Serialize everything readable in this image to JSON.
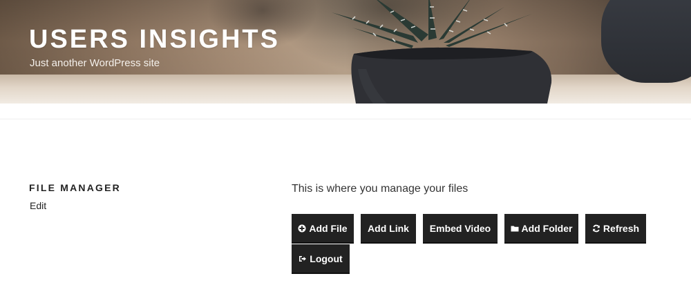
{
  "site": {
    "title": "USERS INSIGHTS",
    "description": "Just another WordPress site"
  },
  "page": {
    "title": "FILE MANAGER",
    "edit_label": "Edit",
    "intro": "This is where you manage your files"
  },
  "toolbar": {
    "buttons": [
      {
        "label": "Add File",
        "icon": "plus-circle-icon"
      },
      {
        "label": "Add Link",
        "icon": ""
      },
      {
        "label": "Embed Video",
        "icon": ""
      },
      {
        "label": "Add Folder",
        "icon": "folder-icon"
      },
      {
        "label": "Refresh",
        "icon": "refresh-icon"
      },
      {
        "label": "Logout",
        "icon": "sign-out-icon"
      }
    ]
  },
  "colors": {
    "button_bg": "#222222",
    "button_text": "#ffffff",
    "text": "#222222"
  }
}
